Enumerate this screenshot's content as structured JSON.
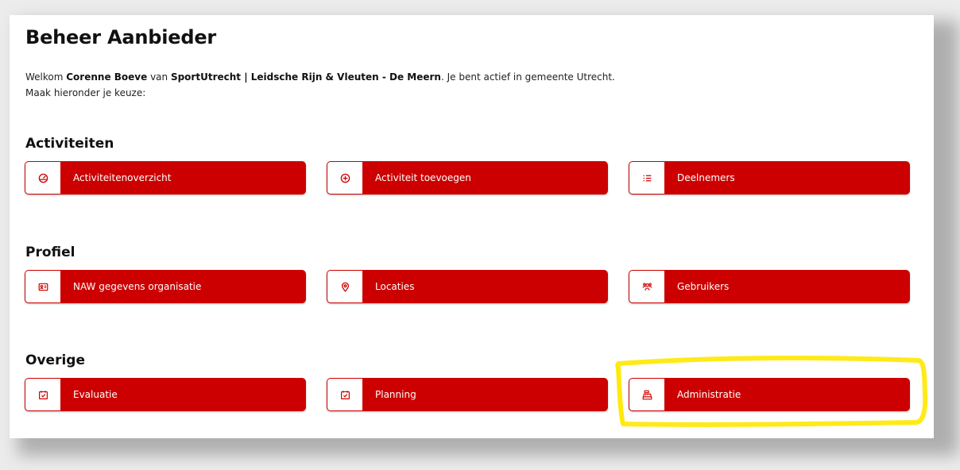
{
  "page": {
    "title": "Beheer Aanbieder",
    "welcome": {
      "prefix": "Welkom ",
      "user": "Corenne Boeve",
      "middle": " van ",
      "organisation": "SportUtrecht | Leidsche Rijn & Vleuten - De Meern",
      "suffix": ". Je bent actief in gemeente Utrecht."
    },
    "instruction": "Maak hieronder je keuze:"
  },
  "sections": [
    {
      "title": "Activiteiten",
      "tiles": [
        {
          "label": "Activiteitenoverzicht",
          "icon": "dashboard-icon"
        },
        {
          "label": "Activiteit toevoegen",
          "icon": "plus-circle-icon"
        },
        {
          "label": "Deelnemers",
          "icon": "list-icon"
        }
      ]
    },
    {
      "title": "Profiel",
      "tiles": [
        {
          "label": "NAW gegevens organisatie",
          "icon": "id-card-icon"
        },
        {
          "label": "Locaties",
          "icon": "map-pin-icon"
        },
        {
          "label": "Gebruikers",
          "icon": "users-icon"
        }
      ]
    },
    {
      "title": "Overige",
      "tiles": [
        {
          "label": "Evaluatie",
          "icon": "calendar-check-icon"
        },
        {
          "label": "Planning",
          "icon": "calendar-check-icon"
        },
        {
          "label": "Administratie",
          "icon": "cash-register-icon"
        }
      ]
    }
  ],
  "colors": {
    "accent": "#cc0000",
    "highlight": "#ffe800"
  }
}
